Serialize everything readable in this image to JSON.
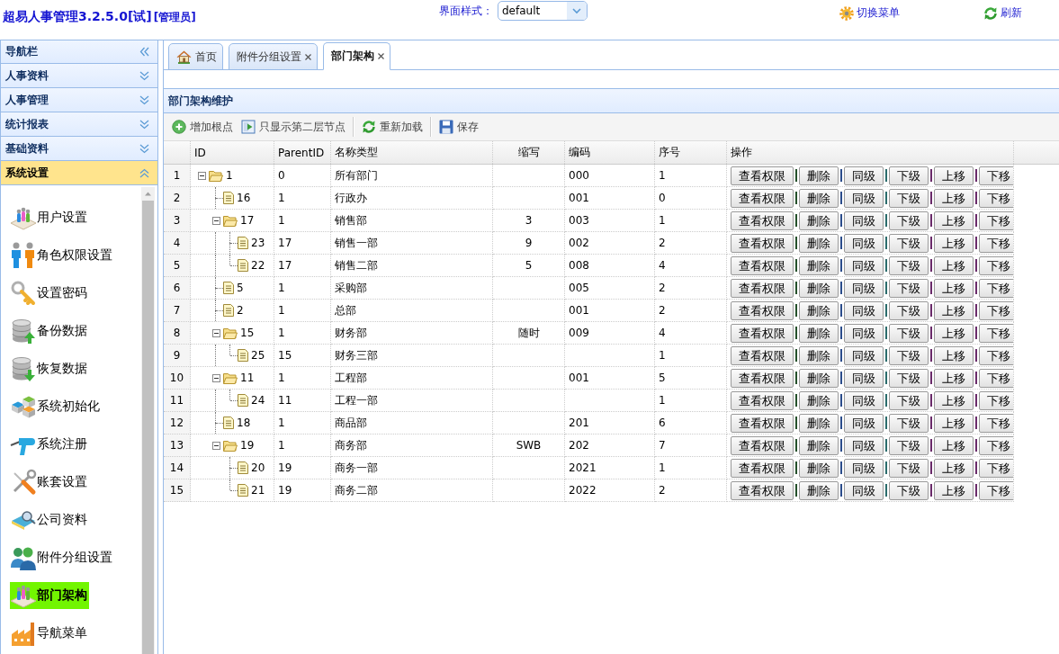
{
  "header": {
    "title": "超易人事管理3.2.5.0[试]",
    "role": "[管理员]",
    "style_selector": {
      "label": "界面样式：",
      "value": "default"
    },
    "actions": [
      {
        "kind": "switch_menu",
        "label": "切换菜单"
      },
      {
        "kind": "refresh",
        "label": "刷新"
      }
    ]
  },
  "sidebar": {
    "title": "导航栏",
    "panels": [
      {
        "title": "人事资料",
        "expanded": false
      },
      {
        "title": "人事管理",
        "expanded": false
      },
      {
        "title": "统计报表",
        "expanded": false
      },
      {
        "title": "基础资料",
        "expanded": false
      },
      {
        "title": "系统设置",
        "expanded": true,
        "items": [
          {
            "label": "用户设置",
            "selected": false
          },
          {
            "label": "角色权限设置",
            "selected": false
          },
          {
            "label": "设置密码",
            "selected": false
          },
          {
            "label": "备份数据",
            "selected": false
          },
          {
            "label": "恢复数据",
            "selected": false
          },
          {
            "label": "系统初始化",
            "selected": false
          },
          {
            "label": "系统注册",
            "selected": false
          },
          {
            "label": "账套设置",
            "selected": false
          },
          {
            "label": "公司资料",
            "selected": false
          },
          {
            "label": "附件分组设置",
            "selected": false
          },
          {
            "label": "部门架构",
            "selected": true
          },
          {
            "label": "导航菜单",
            "selected": false
          }
        ]
      }
    ]
  },
  "tabs": [
    {
      "kind": "home",
      "label": "首页",
      "closable": false,
      "selected": false
    },
    {
      "kind": "page",
      "label": "附件分组设置",
      "closable": true,
      "selected": false
    },
    {
      "kind": "page",
      "label": "部门架构",
      "closable": true,
      "selected": true
    }
  ],
  "panel": {
    "title": "部门架构维护",
    "toolbar": [
      {
        "kind": "add",
        "label": "增加根点"
      },
      {
        "kind": "filter",
        "label": "只显示第二层节点"
      },
      {
        "kind": "separator"
      },
      {
        "kind": "reload",
        "label": "重新加载"
      },
      {
        "kind": "separator"
      },
      {
        "kind": "save",
        "label": "保存"
      }
    ]
  },
  "grid": {
    "columns": [
      "ID",
      "ParentID",
      "名称类型",
      "缩写",
      "编码",
      "序号",
      "操作"
    ],
    "rows": [
      {
        "row_number": "1",
        "id": "1",
        "parent_id": "0",
        "name": "所有部门",
        "code": "000",
        "order": "1",
        "actions": [
          "查看权限",
          "删除",
          "同级",
          "下级",
          "上移",
          "下移"
        ],
        "expanded": true,
        "children": [
          {
            "row_number": "2",
            "id": "16",
            "parent_id": "1",
            "name": "行政办",
            "code": "001",
            "order": "0",
            "actions": [
              "查看权限",
              "删除",
              "同级",
              "下级",
              "上移",
              "下移"
            ]
          },
          {
            "row_number": "3",
            "id": "17",
            "parent_id": "1",
            "name": "销售部",
            "abbreviation": "3",
            "code": "003",
            "order": "1",
            "actions": [
              "查看权限",
              "删除",
              "同级",
              "下级",
              "上移",
              "下移"
            ],
            "expanded": true,
            "children": [
              {
                "row_number": "4",
                "id": "23",
                "parent_id": "17",
                "name": "销售一部",
                "abbreviation": "9",
                "code": "002",
                "order": "2",
                "actions": [
                  "查看权限",
                  "删除",
                  "同级",
                  "下级",
                  "上移",
                  "下移"
                ]
              },
              {
                "row_number": "5",
                "id": "22",
                "parent_id": "17",
                "name": "销售二部",
                "abbreviation": "5",
                "code": "008",
                "order": "4",
                "actions": [
                  "查看权限",
                  "删除",
                  "同级",
                  "下级",
                  "上移",
                  "下移"
                ]
              }
            ]
          },
          {
            "row_number": "6",
            "id": "5",
            "parent_id": "1",
            "name": "采购部",
            "code": "005",
            "order": "2",
            "actions": [
              "查看权限",
              "删除",
              "同级",
              "下级",
              "上移",
              "下移"
            ]
          },
          {
            "row_number": "7",
            "id": "2",
            "parent_id": "1",
            "name": "总部",
            "code": "001",
            "order": "2",
            "actions": [
              "查看权限",
              "删除",
              "同级",
              "下级",
              "上移",
              "下移"
            ]
          },
          {
            "row_number": "8",
            "id": "15",
            "parent_id": "1",
            "name": "财务部",
            "abbreviation": "随时",
            "code": "009",
            "order": "4",
            "actions": [
              "查看权限",
              "删除",
              "同级",
              "下级",
              "上移",
              "下移"
            ],
            "expanded": true,
            "children": [
              {
                "row_number": "9",
                "id": "25",
                "parent_id": "15",
                "name": "财务三部",
                "order": "1",
                "actions": [
                  "查看权限",
                  "删除",
                  "同级",
                  "下级",
                  "上移",
                  "下移"
                ]
              }
            ]
          },
          {
            "row_number": "10",
            "id": "11",
            "parent_id": "1",
            "name": "工程部",
            "code": "001",
            "order": "5",
            "actions": [
              "查看权限",
              "删除",
              "同级",
              "下级",
              "上移",
              "下移"
            ],
            "expanded": true,
            "children": [
              {
                "row_number": "11",
                "id": "24",
                "parent_id": "11",
                "name": "工程一部",
                "order": "1",
                "actions": [
                  "查看权限",
                  "删除",
                  "同级",
                  "下级",
                  "上移",
                  "下移"
                ]
              }
            ]
          },
          {
            "row_number": "12",
            "id": "18",
            "parent_id": "1",
            "name": "商品部",
            "code": "201",
            "order": "6",
            "actions": [
              "查看权限",
              "删除",
              "同级",
              "下级",
              "上移",
              "下移"
            ]
          },
          {
            "row_number": "13",
            "id": "19",
            "parent_id": "1",
            "name": "商务部",
            "abbreviation": "SWB",
            "code": "202",
            "order": "7",
            "actions": [
              "查看权限",
              "删除",
              "同级",
              "下级",
              "上移",
              "下移"
            ],
            "expanded": true,
            "children": [
              {
                "row_number": "14",
                "id": "20",
                "parent_id": "19",
                "name": "商务一部",
                "code": "2021",
                "order": "1",
                "actions": [
                  "查看权限",
                  "删除",
                  "同级",
                  "下级",
                  "上移",
                  "下移"
                ]
              },
              {
                "row_number": "15",
                "id": "21",
                "parent_id": "19",
                "name": "商务二部",
                "code": "2022",
                "order": "2",
                "actions": [
                  "查看权限",
                  "删除",
                  "同级",
                  "下级",
                  "上移",
                  "下移"
                ]
              }
            ]
          }
        ]
      }
    ]
  }
}
